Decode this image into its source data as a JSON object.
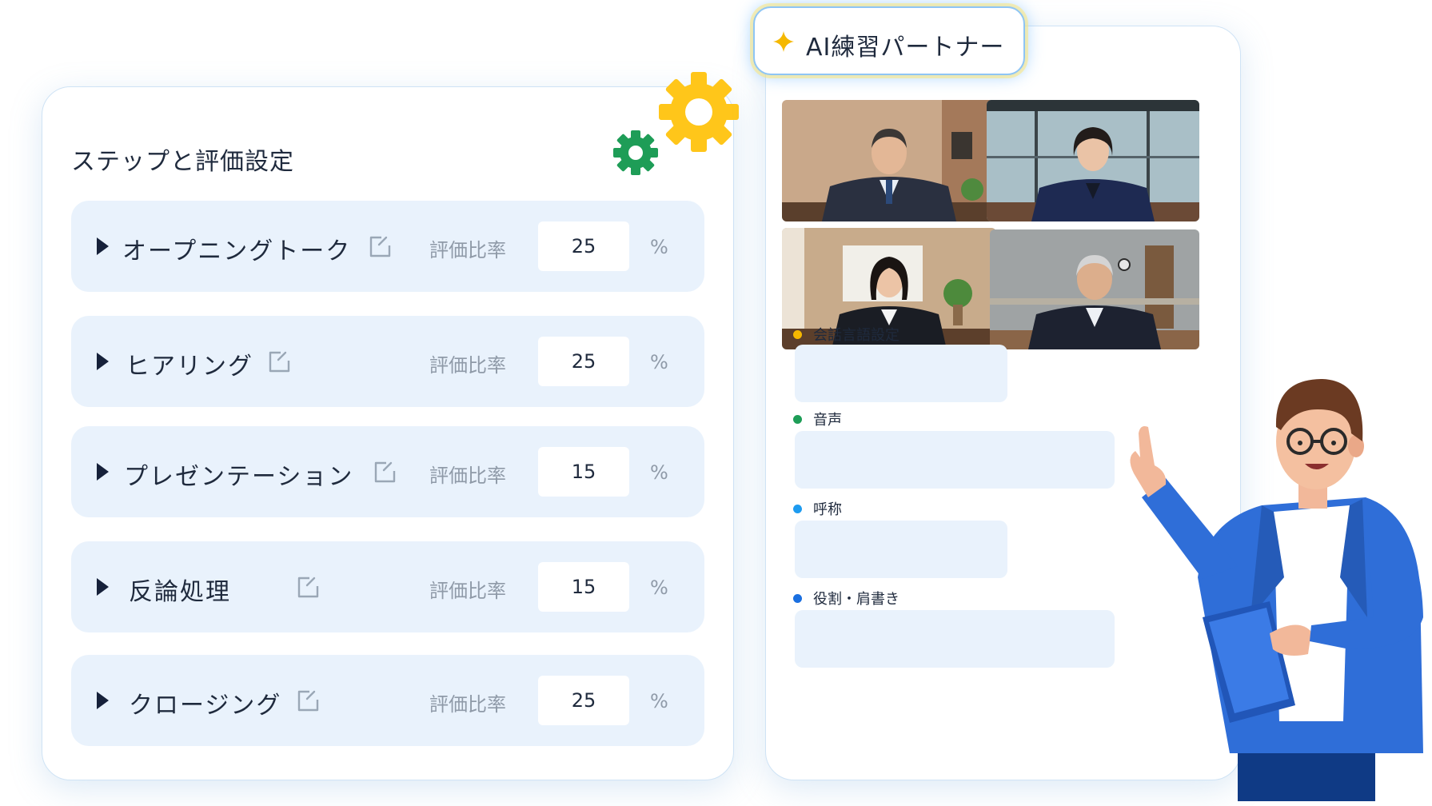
{
  "steps_panel": {
    "title": "ステップと評価設定",
    "ratio_label": "評価比率",
    "unit": "%",
    "steps": [
      {
        "name": "オープニングトーク",
        "ratio": "25"
      },
      {
        "name": "ヒアリング",
        "ratio": "25"
      },
      {
        "name": "プレゼンテーション",
        "ratio": "15"
      },
      {
        "name": "反論処理",
        "ratio": "15"
      },
      {
        "name": "クロージング",
        "ratio": "25"
      }
    ]
  },
  "partner_panel": {
    "badge_title": "AI練習パートナー",
    "fields": [
      {
        "label": "会話言語設定",
        "color": "#f5b800"
      },
      {
        "label": "音声",
        "color": "#1e9d57"
      },
      {
        "label": "呼称",
        "color": "#1d9bf0"
      },
      {
        "label": "役割・肩書き",
        "color": "#1a6fe0"
      }
    ]
  },
  "colors": {
    "accent_blue": "#1a6fe0",
    "row_bg": "#e9f2fc",
    "gear_yellow": "#ffc61a",
    "gear_green": "#1e9d57"
  }
}
